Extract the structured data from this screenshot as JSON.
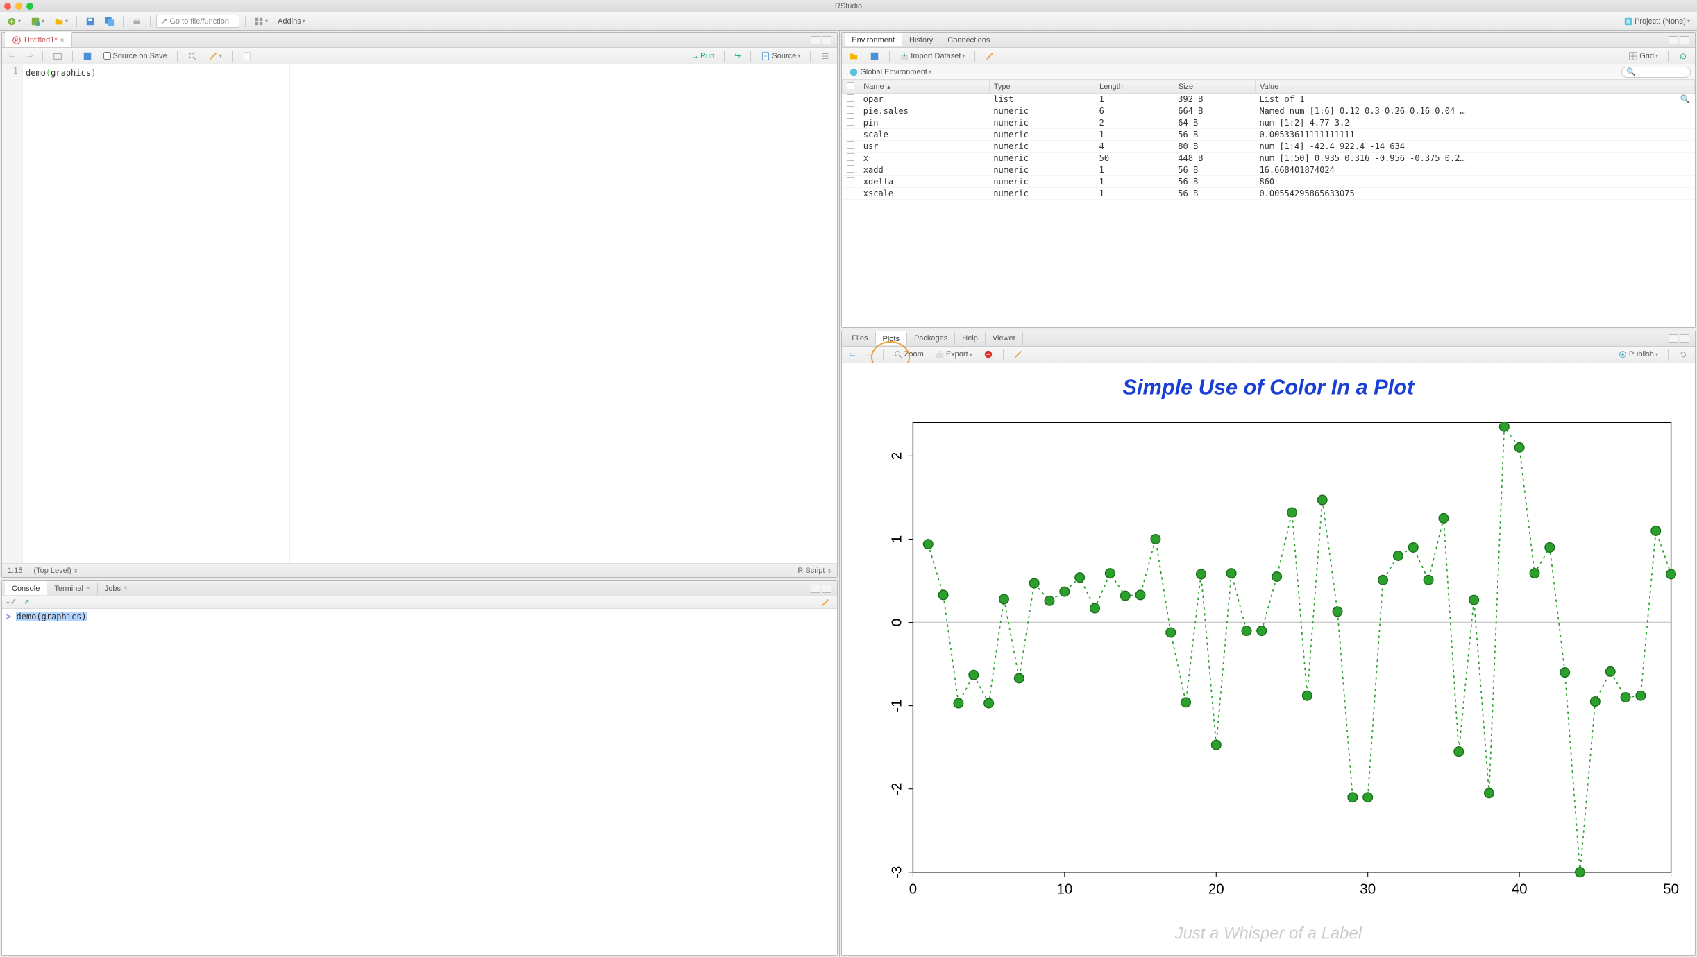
{
  "window": {
    "title": "RStudio",
    "project_label": "Project: (None)"
  },
  "toolbar": {
    "goto_placeholder": "Go to file/function",
    "addins_label": "Addins"
  },
  "source": {
    "tab_label": "Untitled1*",
    "source_on_save_label": "Source on Save",
    "run_label": "Run",
    "source_btn_label": "Source",
    "line_number": "1",
    "code_text": "demo(graphics)",
    "cursor_pos": "1:15",
    "scope_label": "(Top Level)",
    "lang_label": "R Script"
  },
  "console": {
    "tabs": [
      "Console",
      "Terminal",
      "Jobs"
    ],
    "wd": "~/",
    "prompt": ">",
    "command": "demo(graphics)"
  },
  "env": {
    "tabs": [
      "Environment",
      "History",
      "Connections"
    ],
    "import_label": "Import Dataset",
    "scope_label": "Global Environment",
    "grid_label": "Grid",
    "columns": [
      "",
      "Name",
      "Type",
      "Length",
      "Size",
      "Value"
    ],
    "rows": [
      {
        "name": "opar",
        "type": "list",
        "length": "1",
        "size": "392 B",
        "value": "List of 1"
      },
      {
        "name": "pie.sales",
        "type": "numeric",
        "length": "6",
        "size": "664 B",
        "value": "Named num [1:6] 0.12 0.3 0.26 0.16 0.04 …"
      },
      {
        "name": "pin",
        "type": "numeric",
        "length": "2",
        "size": "64 B",
        "value": "num [1:2] 4.77 3.2"
      },
      {
        "name": "scale",
        "type": "numeric",
        "length": "1",
        "size": "56 B",
        "value": "0.00533611111111111"
      },
      {
        "name": "usr",
        "type": "numeric",
        "length": "4",
        "size": "80 B",
        "value": "num [1:4] -42.4 922.4 -14 634"
      },
      {
        "name": "x",
        "type": "numeric",
        "length": "50",
        "size": "448 B",
        "value": "num [1:50] 0.935 0.316 -0.956 -0.375 0.2…"
      },
      {
        "name": "xadd",
        "type": "numeric",
        "length": "1",
        "size": "56 B",
        "value": "16.668401874024"
      },
      {
        "name": "xdelta",
        "type": "numeric",
        "length": "1",
        "size": "56 B",
        "value": "860"
      },
      {
        "name": "xscale",
        "type": "numeric",
        "length": "1",
        "size": "56 B",
        "value": "0.00554295865633075"
      }
    ]
  },
  "plots": {
    "tabs": [
      "Files",
      "Plots",
      "Packages",
      "Help",
      "Viewer"
    ],
    "zoom_label": "Zoom",
    "export_label": "Export",
    "publish_label": "Publish"
  },
  "chart_data": {
    "type": "line",
    "title": "Simple Use of Color In a Plot",
    "subtitle": "Just a Whisper of a Label",
    "xlabel": "",
    "ylabel": "",
    "xlim": [
      0,
      50
    ],
    "ylim": [
      -3,
      2.4
    ],
    "x_ticks": [
      0,
      10,
      20,
      30,
      40,
      50
    ],
    "y_ticks": [
      -3,
      -2,
      -1,
      0,
      1,
      2
    ],
    "x": [
      1,
      2,
      3,
      4,
      5,
      6,
      7,
      8,
      9,
      10,
      11,
      12,
      13,
      14,
      15,
      16,
      17,
      18,
      19,
      20,
      21,
      22,
      23,
      24,
      25,
      26,
      27,
      28,
      29,
      30,
      31,
      32,
      33,
      34,
      35,
      36,
      37,
      38,
      39,
      40,
      41,
      42,
      43,
      44,
      45,
      46,
      47,
      48,
      49,
      50
    ],
    "y": [
      0.94,
      0.33,
      -0.97,
      -0.63,
      -0.97,
      0.28,
      -0.67,
      0.47,
      0.26,
      0.37,
      0.54,
      0.17,
      0.59,
      0.32,
      0.33,
      1.0,
      -0.12,
      -0.96,
      0.58,
      -1.47,
      0.59,
      -0.1,
      -0.1,
      0.55,
      1.32,
      -0.88,
      1.47,
      0.13,
      -2.1,
      -2.1,
      0.51,
      0.8,
      0.9,
      0.51,
      1.25,
      -1.55,
      0.27,
      -2.05,
      2.35,
      2.1,
      0.59,
      0.9,
      -0.6,
      -3.0,
      -0.95,
      -0.59,
      -0.9,
      -0.88,
      1.1,
      0.58
    ],
    "point_color": "#2ca02c",
    "line_style": "dotted"
  }
}
